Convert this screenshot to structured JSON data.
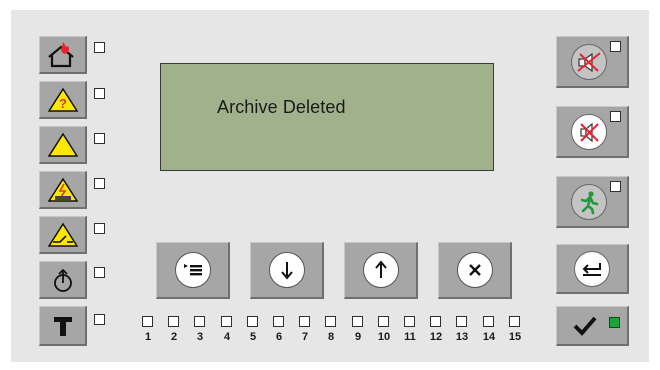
{
  "lcd": {
    "message": "Archive Deleted"
  },
  "zones": {
    "labels": [
      "1",
      "2",
      "3",
      "4",
      "5",
      "6",
      "7",
      "8",
      "9",
      "10",
      "11",
      "12",
      "13",
      "14",
      "15"
    ]
  },
  "status_indicators": [
    {
      "icon": "fire-alarm-icon",
      "led": "off"
    },
    {
      "icon": "prealarm-icon",
      "led": "off"
    },
    {
      "icon": "fault-icon",
      "led": "off"
    },
    {
      "icon": "power-fault-icon",
      "led": "off"
    },
    {
      "icon": "disablement-icon",
      "led": "off"
    },
    {
      "icon": "power-icon",
      "led": "off"
    },
    {
      "icon": "test-icon",
      "led": "off"
    }
  ],
  "colors": {
    "panel": "#e6e6e6",
    "button": "#a6a6a6",
    "lcd": "#a1b18b",
    "led_on": "#1aa53a",
    "alarm_red": "#e8232f",
    "warning_yellow": "#ffe800",
    "exit_green": "#1e9a3c"
  }
}
